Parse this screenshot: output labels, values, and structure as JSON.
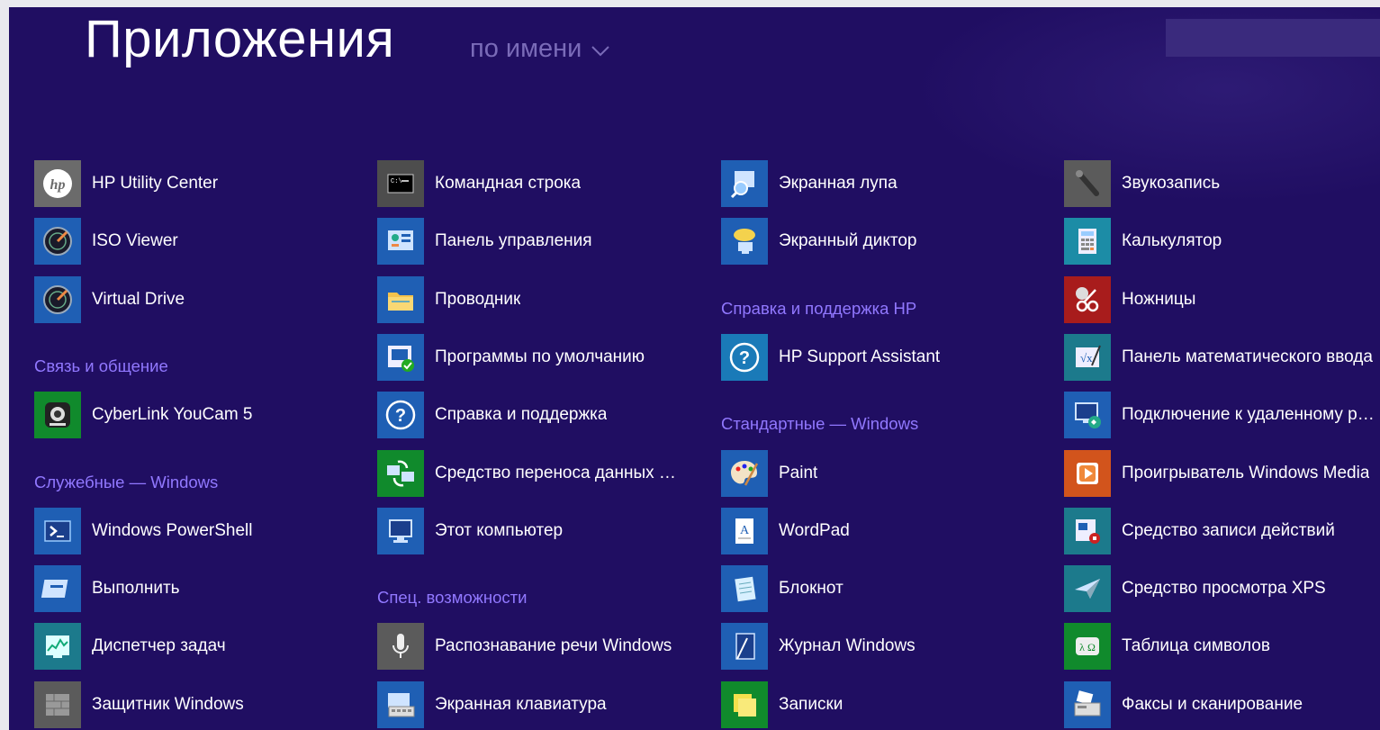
{
  "header": {
    "title": "Приложения",
    "sort_label": "по имени"
  },
  "colors": {
    "background": "#200e62",
    "group_header": "#9178ff",
    "sort_text": "#7a6bb8"
  },
  "columns": [
    {
      "entries": [
        {
          "type": "app",
          "label": "HP Utility Center",
          "icon": "hp-logo-icon",
          "tile": "#6b6b6b"
        },
        {
          "type": "app",
          "label": "ISO Viewer",
          "icon": "iso-viewer-icon",
          "tile": "#1f5fb4"
        },
        {
          "type": "app",
          "label": "Virtual Drive",
          "icon": "virtual-drive-icon",
          "tile": "#1f5fb4"
        },
        {
          "type": "group",
          "label": "Связь и общение"
        },
        {
          "type": "app",
          "label": "CyberLink YouCam 5",
          "icon": "webcam-icon",
          "tile": "#108a2c"
        },
        {
          "type": "group",
          "label": "Служебные — Windows"
        },
        {
          "type": "app",
          "label": "Windows PowerShell",
          "icon": "powershell-icon",
          "tile": "#1f5fb4"
        },
        {
          "type": "app",
          "label": "Выполнить",
          "icon": "run-icon",
          "tile": "#1f5fb4"
        },
        {
          "type": "app",
          "label": "Диспетчер задач",
          "icon": "task-manager-icon",
          "tile": "#1c7a8c"
        },
        {
          "type": "app",
          "label": "Защитник Windows",
          "icon": "defender-icon",
          "tile": "#5b5b5b"
        }
      ]
    },
    {
      "entries": [
        {
          "type": "app",
          "label": "Командная строка",
          "icon": "command-prompt-icon",
          "tile": "#4d4d4d"
        },
        {
          "type": "app",
          "label": "Панель управления",
          "icon": "control-panel-icon",
          "tile": "#1f5fb4"
        },
        {
          "type": "app",
          "label": "Проводник",
          "icon": "file-explorer-icon",
          "tile": "#1f5fb4"
        },
        {
          "type": "app",
          "label": "Программы по умолчанию",
          "icon": "default-programs-icon",
          "tile": "#1f5fb4"
        },
        {
          "type": "app",
          "label": "Справка и поддержка",
          "icon": "help-icon",
          "tile": "#1f5fb4"
        },
        {
          "type": "app",
          "label": "Средство переноса данных Wi...",
          "icon": "easy-transfer-icon",
          "tile": "#108a2c"
        },
        {
          "type": "app",
          "label": "Этот компьютер",
          "icon": "computer-icon",
          "tile": "#1f5fb4"
        },
        {
          "type": "group",
          "label": "Спец. возможности"
        },
        {
          "type": "app",
          "label": "Распознавание речи Windows",
          "icon": "microphone-icon",
          "tile": "#5b5b5b"
        },
        {
          "type": "app",
          "label": "Экранная клавиатура",
          "icon": "keyboard-icon",
          "tile": "#1f5fb4"
        }
      ]
    },
    {
      "entries": [
        {
          "type": "app",
          "label": "Экранная лупа",
          "icon": "magnifier-icon",
          "tile": "#1f5fb4"
        },
        {
          "type": "app",
          "label": "Экранный диктор",
          "icon": "narrator-icon",
          "tile": "#1f5fb4"
        },
        {
          "type": "group",
          "label": "Справка и поддержка HP"
        },
        {
          "type": "app",
          "label": "HP Support Assistant",
          "icon": "help-icon",
          "tile": "#1a7ab8"
        },
        {
          "type": "group",
          "label": "Стандартные — Windows"
        },
        {
          "type": "app",
          "label": "Paint",
          "icon": "paint-palette-icon",
          "tile": "#1f5fb4"
        },
        {
          "type": "app",
          "label": "WordPad",
          "icon": "wordpad-icon",
          "tile": "#1f5fb4"
        },
        {
          "type": "app",
          "label": "Блокнот",
          "icon": "notepad-icon",
          "tile": "#1f5fb4"
        },
        {
          "type": "app",
          "label": "Журнал Windows",
          "icon": "journal-icon",
          "tile": "#1f5fb4"
        },
        {
          "type": "app",
          "label": "Записки",
          "icon": "sticky-notes-icon",
          "tile": "#108a2c"
        }
      ]
    },
    {
      "entries": [
        {
          "type": "app",
          "label": "Звукозапись",
          "icon": "sound-recorder-icon",
          "tile": "#5b5b5b"
        },
        {
          "type": "app",
          "label": "Калькулятор",
          "icon": "calculator-icon",
          "tile": "#1c8ca6"
        },
        {
          "type": "app",
          "label": "Ножницы",
          "icon": "snipping-tool-icon",
          "tile": "#a81c1c"
        },
        {
          "type": "app",
          "label": "Панель математического ввода",
          "icon": "math-input-icon",
          "tile": "#1c7a8c"
        },
        {
          "type": "app",
          "label": "Подключение к удаленному ра...",
          "icon": "remote-desktop-icon",
          "tile": "#1f5fb4"
        },
        {
          "type": "app",
          "label": "Проигрыватель Windows Media",
          "icon": "media-player-icon",
          "tile": "#d2541c"
        },
        {
          "type": "app",
          "label": "Средство записи действий",
          "icon": "steps-recorder-icon",
          "tile": "#1c7a8c"
        },
        {
          "type": "app",
          "label": "Средство просмотра XPS",
          "icon": "xps-viewer-icon",
          "tile": "#1c7a8c"
        },
        {
          "type": "app",
          "label": "Таблица символов",
          "icon": "character-map-icon",
          "tile": "#108a2c"
        },
        {
          "type": "app",
          "label": "Факсы и сканирование",
          "icon": "fax-icon",
          "tile": "#1f5fb4"
        }
      ]
    }
  ]
}
